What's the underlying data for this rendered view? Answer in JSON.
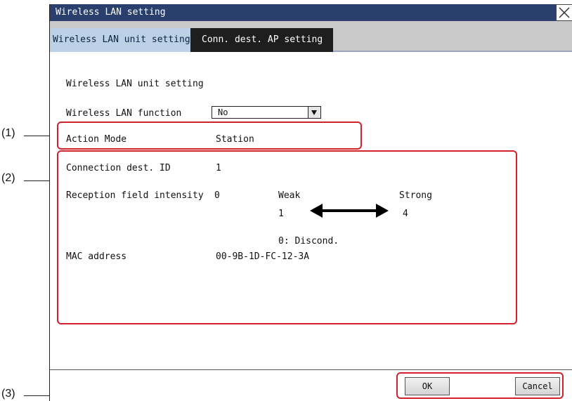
{
  "window": {
    "title": "Wireless LAN setting"
  },
  "tabs": [
    {
      "label": "Wireless LAN unit setting",
      "active": true
    },
    {
      "label": "Conn. dest. AP setting",
      "active": false
    }
  ],
  "section_title": "Wireless LAN unit setting",
  "wireless_function": {
    "label": "Wireless LAN function",
    "value": "No"
  },
  "action_mode": {
    "label": "Action Mode",
    "value": "Station"
  },
  "connection": {
    "label": "Connection dest. ID",
    "value": "1"
  },
  "reception": {
    "label": "Reception field intensity",
    "value": "0",
    "weak_label": "Weak",
    "strong_label": "Strong",
    "min": "1",
    "max": "4",
    "disconnected_note": "0: Discond."
  },
  "mac": {
    "label": "MAC address",
    "value": "00-9B-1D-FC-12-3A"
  },
  "buttons": {
    "ok": "OK",
    "cancel": "Cancel"
  },
  "callouts": [
    "(1)",
    "(2)",
    "(3)"
  ],
  "colors": {
    "titlebar": "#2a3f6b",
    "active_tab": "#bcd0e6",
    "inactive_tab": "#1e1e1e",
    "callout": "#d3212c"
  },
  "icons": {
    "close": "close-icon",
    "dropdown": "dropdown-arrow-icon",
    "range": "double-arrow-icon"
  }
}
